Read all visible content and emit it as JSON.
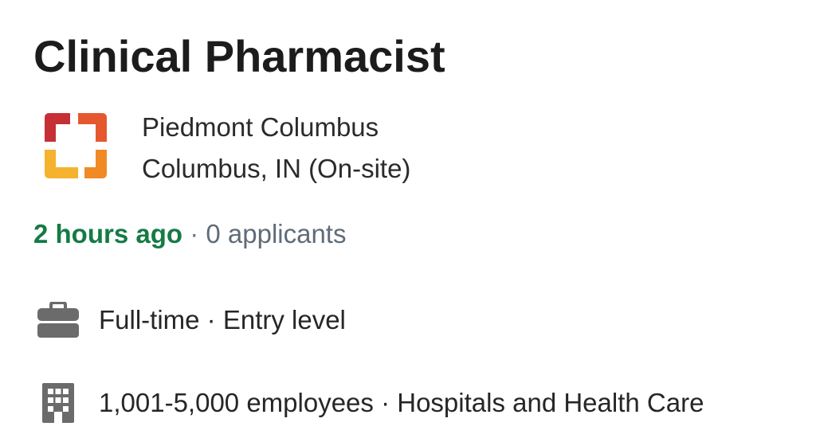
{
  "job": {
    "title": "Clinical Pharmacist"
  },
  "company": {
    "name": "Piedmont Columbus",
    "location": "Columbus, IN (On-site)",
    "logo_colors": [
      "#c62f35",
      "#e5582f",
      "#f08a24",
      "#f4b22e"
    ]
  },
  "meta": {
    "posted": "2 hours ago",
    "separator": " · ",
    "applicants": "0 applicants",
    "posted_color": "#157a46",
    "applicants_color": "#5f6c78"
  },
  "details": {
    "job_type": {
      "icon": "briefcase-icon",
      "text": "Full-time · Entry level"
    },
    "company_size": {
      "icon": "building-icon",
      "text": "1,001-5,000 employees · Hospitals and Health Care"
    },
    "icon_color": "#6b6b6b"
  }
}
